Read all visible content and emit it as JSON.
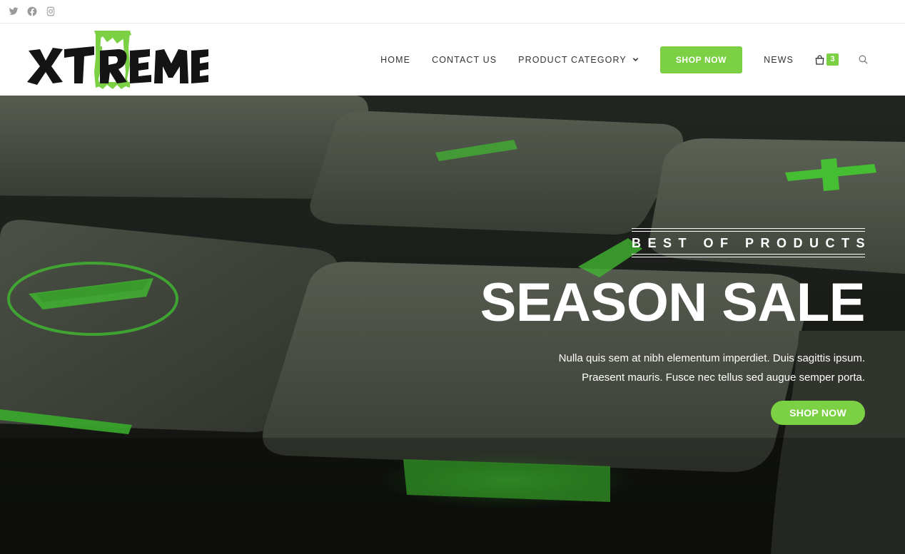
{
  "topbar": {
    "social": [
      {
        "icon": "twitter-icon"
      },
      {
        "icon": "facebook-icon"
      },
      {
        "icon": "instagram-icon"
      }
    ]
  },
  "brand": {
    "logo_text": "XTREME",
    "accent_color": "#7bd043"
  },
  "nav": {
    "items": [
      {
        "label": "HOME"
      },
      {
        "label": "CONTACT US"
      },
      {
        "label": "PRODUCT CATEGORY",
        "has_dropdown": true
      },
      {
        "label": "SHOP NOW",
        "highlighted": true
      },
      {
        "label": "NEWS"
      }
    ],
    "cart_count": "3",
    "cart_icon": "shopping-bag-icon",
    "search_icon": "search-icon"
  },
  "hero": {
    "kicker": "BEST OF PRODUCTS",
    "headline": "SEASON SALE",
    "paragraph_line1": "Nulla quis sem at nibh elementum imperdiet. Duis sagittis ipsum.",
    "paragraph_line2": "Praesent mauris. Fusce nec tellus sed augue semper porta.",
    "button_label": "SHOP NOW"
  }
}
